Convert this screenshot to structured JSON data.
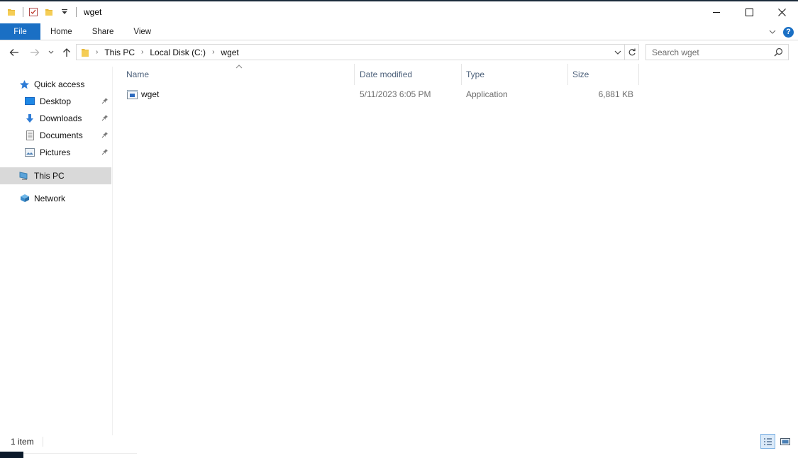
{
  "window": {
    "title": "wget"
  },
  "ribbon": {
    "tabs": [
      "File",
      "Home",
      "Share",
      "View"
    ]
  },
  "address": {
    "crumbs": [
      "This PC",
      "Local Disk (C:)",
      "wget"
    ],
    "search_placeholder": "Search wget"
  },
  "nav": {
    "quick_access": "Quick access",
    "items": [
      "Desktop",
      "Downloads",
      "Documents",
      "Pictures"
    ],
    "this_pc": "This PC",
    "network": "Network"
  },
  "columns": {
    "name": "Name",
    "date": "Date modified",
    "type": "Type",
    "size": "Size"
  },
  "files": [
    {
      "name": "wget",
      "date": "5/11/2023 6:05 PM",
      "type": "Application",
      "size": "6,881 KB"
    }
  ],
  "status": {
    "count": "1 item"
  },
  "colors": {
    "accent": "#1a6fc4",
    "header_text": "#4c607a",
    "selection": "#d9d9d9"
  }
}
